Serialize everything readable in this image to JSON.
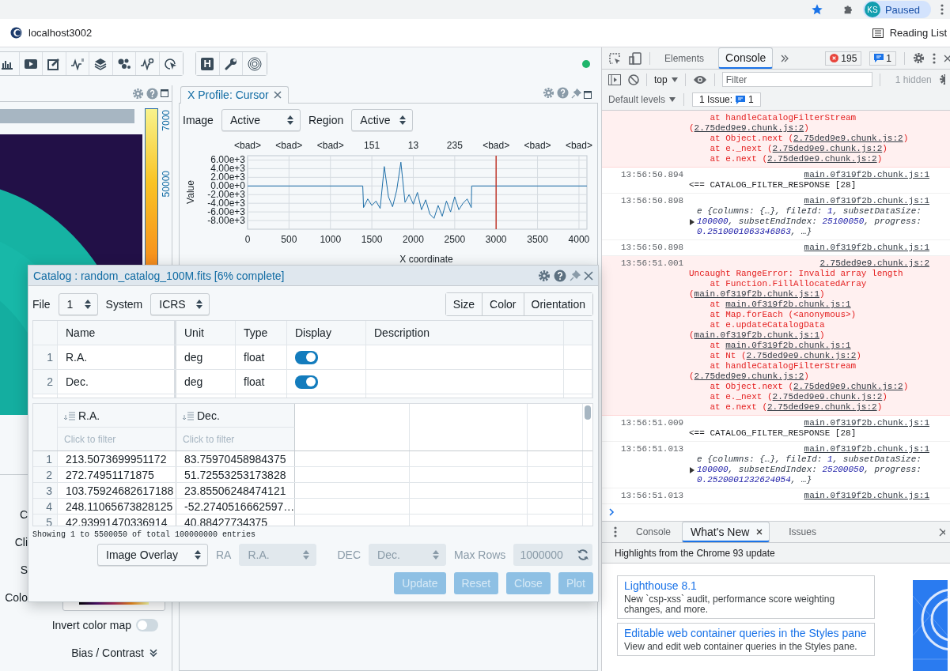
{
  "browser": {
    "avatar_initials": "KS",
    "profile_status": "Paused",
    "address": "localhost3002",
    "reading_list": "Reading List"
  },
  "app": {
    "toolbar_letter": "H",
    "image_panel": {
      "colorbar_labels": [
        "7000",
        "50000"
      ]
    },
    "render_config": {
      "cut_labels": [
        "C",
        "Cli",
        "S",
        "Colo"
      ],
      "invert": {
        "label": "Invert color map",
        "on": false
      },
      "bias_contrast": "Bias / Contrast"
    },
    "profile": {
      "tab": "X Profile: Cursor",
      "image_label": "Image",
      "image_value": "Active",
      "region_label": "Region",
      "region_value": "Active",
      "top_labels": [
        "<bad>",
        "<bad>",
        "<bad>",
        "151",
        "13",
        "235",
        "<bad>",
        "<bad>",
        "<bad>"
      ],
      "chart_data": {
        "type": "line",
        "xlabel": "X coordinate",
        "ylabel": "Value",
        "xlim": [
          0,
          4096
        ],
        "ylim": [
          -10000,
          7000
        ],
        "xticks": [
          0,
          500,
          1000,
          1500,
          2000,
          2500,
          3000,
          3500,
          4000
        ],
        "yticks": [
          {
            "value": 6000,
            "label": "6.00e+3"
          },
          {
            "value": 4000,
            "label": "4.00e+3"
          },
          {
            "value": 2000,
            "label": "2.00e+3"
          },
          {
            "value": 0,
            "label": "0.00e+0"
          },
          {
            "value": -2000,
            "label": "-2.00e+3"
          },
          {
            "value": -4000,
            "label": "-4.00e+3"
          },
          {
            "value": -6000,
            "label": "-6.00e+3"
          },
          {
            "value": -8000,
            "label": "-8.00e+3"
          }
        ],
        "x": [
          0,
          1390,
          1400,
          1450,
          1500,
          1550,
          1600,
          1650,
          1700,
          1750,
          1800,
          1850,
          1900,
          1950,
          2000,
          2050,
          2100,
          2150,
          2200,
          2250,
          2300,
          2350,
          2400,
          2450,
          2500,
          2550,
          2600,
          2650,
          2700,
          2705,
          4096
        ],
        "grid": true,
        "series": [
          {
            "color": "#1f6fa8",
            "values": [
              0,
              0,
              -5000,
              -3000,
              -4500,
              -3500,
              -5200,
              4500,
              -2500,
              -4800,
              -1000,
              5500,
              -3800,
              -2000,
              -4200,
              -1500,
              -5500,
              -3200,
              -6500,
              -7500,
              -4500,
              -7000,
              -3500,
              -6000,
              -2500,
              -5500,
              -4000,
              -3000,
              -5000,
              0,
              0
            ]
          }
        ],
        "ref_lines": [
          {
            "axis": "x",
            "value": 3000
          }
        ]
      }
    },
    "catalog": {
      "title": "Catalog : random_catalog_100M.fits [6% complete]",
      "file_label": "File",
      "file_value": "1",
      "system_label": "System",
      "system_value": "ICRS",
      "style_buttons": [
        "Size",
        "Color",
        "Orientation"
      ],
      "column_headers": [
        "Name",
        "Unit",
        "Type",
        "Display",
        "Description"
      ],
      "columns": [
        {
          "index": "1",
          "name": "R.A.",
          "unit": "deg",
          "type": "float",
          "display": true
        },
        {
          "index": "2",
          "name": "Dec.",
          "unit": "deg",
          "type": "float",
          "display": true
        }
      ],
      "data_columns": [
        {
          "name": "R.A.",
          "filter_placeholder": "Click to filter"
        },
        {
          "name": "Dec.",
          "filter_placeholder": "Click to filter"
        }
      ],
      "rows": [
        {
          "index": "1",
          "cells": [
            "213.5073699951172",
            "83.75970458984375"
          ]
        },
        {
          "index": "2",
          "cells": [
            "272.74951171875",
            "51.72553253173828"
          ]
        },
        {
          "index": "3",
          "cells": [
            "103.75924682617188",
            "23.85506248474121"
          ]
        },
        {
          "index": "4",
          "cells": [
            "248.11065673828125",
            "-52.2740516662597…"
          ]
        },
        {
          "index": "5",
          "cells": [
            "42.93991470336914",
            "40.88427734375"
          ]
        }
      ],
      "status": "Showing 1 to 5500050 of total 100000000 entries",
      "overlay": {
        "value": "Image Overlay"
      },
      "ra": {
        "label": "RA",
        "value": "R.A.",
        "disabled": true
      },
      "dec": {
        "label": "DEC",
        "value": "Dec.",
        "disabled": true
      },
      "max_rows": {
        "label": "Max Rows",
        "value": "1000000",
        "disabled": true
      },
      "actions": [
        {
          "label": "Update",
          "disabled": true
        },
        {
          "label": "Reset",
          "disabled": true
        },
        {
          "label": "Close",
          "disabled": true
        },
        {
          "label": "Plot",
          "disabled": true
        }
      ]
    }
  },
  "devtools": {
    "tabs": [
      {
        "label": "Elements",
        "selected": false
      },
      {
        "label": "Console",
        "selected": true
      }
    ],
    "error_count": "195",
    "issue_count": "1",
    "context": "top",
    "filter_placeholder": "Filter",
    "hidden": "1 hidden",
    "levels": "Default levels",
    "issues_label": "1 Issue:",
    "issues_badge": "1",
    "messages": [
      {
        "kind": "error",
        "frames": [
          {
            "text": "at handleCatalogFilterStream (",
            "link": "2.75ded9e9.chunk.js:2",
            "tail": ")"
          },
          {
            "text": "at Object.next (",
            "link": "2.75ded9e9.chunk.js:2",
            "tail": ")"
          },
          {
            "text": "at e._next (",
            "link": "2.75ded9e9.chunk.js:2",
            "tail": ")"
          },
          {
            "text": "at e.next (",
            "link": "2.75ded9e9.chunk.js:2",
            "tail": ")"
          }
        ]
      },
      {
        "kind": "log",
        "time": "13:56:50.894",
        "text": "<== CATALOG_FILTER_RESPONSE [28]",
        "source": "main.0f319f2b.chunk.js:1"
      },
      {
        "kind": "object",
        "time": "13:56:50.898",
        "source": "main.0f319f2b.chunk.js:1",
        "parts": [
          {
            "text": "e {columns: {…}, fileId: ",
            "kind": "text"
          },
          {
            "text": "1",
            "kind": "number"
          },
          {
            "text": ", subsetDataSize: ",
            "kind": "text"
          },
          {
            "text": "100000",
            "kind": "number"
          },
          {
            "text": ", subsetEndIndex: ",
            "kind": "text"
          },
          {
            "text": "25100050",
            "kind": "number"
          },
          {
            "text": ", progress: ",
            "kind": "text"
          },
          {
            "text": "0.2510001063346863",
            "kind": "number"
          },
          {
            "text": ", …}",
            "kind": "text"
          }
        ]
      },
      {
        "kind": "log",
        "time": "13:56:50.898",
        "source": "main.0f319f2b.chunk.js:1"
      },
      {
        "kind": "error",
        "time": "13:56:51.001",
        "message": "Uncaught RangeError: Invalid array length",
        "source": "2.75ded9e9.chunk.js:2",
        "frames": [
          {
            "text": "at Function.FillAllocatedArray (",
            "link": "main.0f319f2b.chunk.js:1",
            "tail": ")"
          },
          {
            "text": "at ",
            "link": "main.0f319f2b.chunk.js:1"
          },
          {
            "text": "at Map.forEach (<anonymous>)"
          },
          {
            "text": "at e.updateCatalogData (",
            "link": "main.0f319f2b.chunk.js:1",
            "tail": ")"
          },
          {
            "text": "at ",
            "link": "main.0f319f2b.chunk.js:1"
          },
          {
            "text": "at Nt (",
            "link": "2.75ded9e9.chunk.js:2",
            "tail": ")"
          },
          {
            "text": "at handleCatalogFilterStream (",
            "link": "2.75ded9e9.chunk.js:2",
            "tail": ")"
          },
          {
            "text": "at Object.next (",
            "link": "2.75ded9e9.chunk.js:2",
            "tail": ")"
          },
          {
            "text": "at e._next (",
            "link": "2.75ded9e9.chunk.js:2",
            "tail": ")"
          },
          {
            "text": "at e.next (",
            "link": "2.75ded9e9.chunk.js:2",
            "tail": ")"
          }
        ]
      },
      {
        "kind": "log",
        "time": "13:56:51.009",
        "text": "<== CATALOG_FILTER_RESPONSE [28]",
        "source": "main.0f319f2b.chunk.js:1"
      },
      {
        "kind": "object",
        "time": "13:56:51.013",
        "source": "main.0f319f2b.chunk.js:1",
        "parts": [
          {
            "text": "e {columns: {…}, fileId: ",
            "kind": "text"
          },
          {
            "text": "1",
            "kind": "number"
          },
          {
            "text": ", subsetDataSize: ",
            "kind": "text"
          },
          {
            "text": "100000",
            "kind": "number"
          },
          {
            "text": ", subsetEndIndex: ",
            "kind": "text"
          },
          {
            "text": "25200050",
            "kind": "number"
          },
          {
            "text": ", progress: ",
            "kind": "text"
          },
          {
            "text": "0.2520001232624054",
            "kind": "number"
          },
          {
            "text": ", …}",
            "kind": "text"
          }
        ]
      },
      {
        "kind": "log",
        "time": "13:56:51.013",
        "source": "main.0f319f2b.chunk.js:1"
      }
    ],
    "drawer_tabs": [
      {
        "label": "Console",
        "selected": false,
        "closable": false
      },
      {
        "label": "What's New",
        "selected": true,
        "closable": true
      },
      {
        "label": "Issues",
        "selected": false,
        "closable": false
      }
    ],
    "whats_new_title": "Highlights from the Chrome 93 update",
    "cards": [
      {
        "title": "Lighthouse 8.1",
        "text": "New `csp-xss` audit, performance score weighting changes, and more."
      },
      {
        "title": "Editable web container queries in the Styles pane",
        "text": "View and edit web container queries in the Styles pane."
      }
    ]
  }
}
